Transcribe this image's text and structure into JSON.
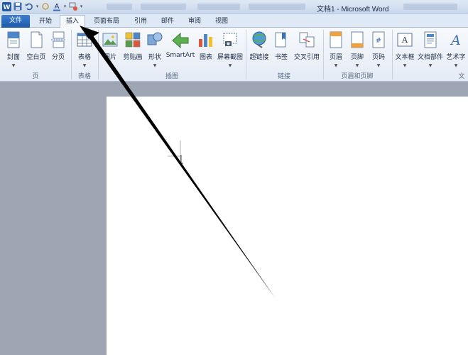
{
  "window": {
    "title": "文档1 - Microsoft Word"
  },
  "qat": {
    "icons": [
      "word-app-icon",
      "save-icon",
      "undo-icon",
      "redo-icon",
      "font-color-icon",
      "format-painter-icon",
      "customize-qat-icon"
    ]
  },
  "tabs": [
    {
      "label": "文件"
    },
    {
      "label": "开始"
    },
    {
      "label": "插入"
    },
    {
      "label": "页面布局"
    },
    {
      "label": "引用"
    },
    {
      "label": "邮件"
    },
    {
      "label": "审阅"
    },
    {
      "label": "视图"
    }
  ],
  "ribbon": {
    "groups": {
      "pages": "页",
      "tables": "表格",
      "illustrations": "插图",
      "links": "链接",
      "header_footer": "页眉和页脚",
      "text": "文"
    },
    "buttons": {
      "cover": "封面",
      "blank_page": "空白页",
      "page_break": "分页",
      "table": "表格",
      "picture": "图片",
      "clip_art": "剪贴画",
      "shapes": "形状",
      "smartart": "SmartArt",
      "chart": "图表",
      "screenshot": "屏幕截图",
      "hyperlink": "超链接",
      "bookmark": "书签",
      "cross_ref": "交叉引用",
      "header": "页眉",
      "footer": "页脚",
      "page_number": "页码",
      "text_box": "文本框",
      "quick_parts": "文档部件",
      "word_art": "艺术字"
    }
  },
  "colors": {
    "accent": "#1f5aa8",
    "ribbon": "#e4ebf5",
    "page_bg": "#9ea6b3"
  }
}
